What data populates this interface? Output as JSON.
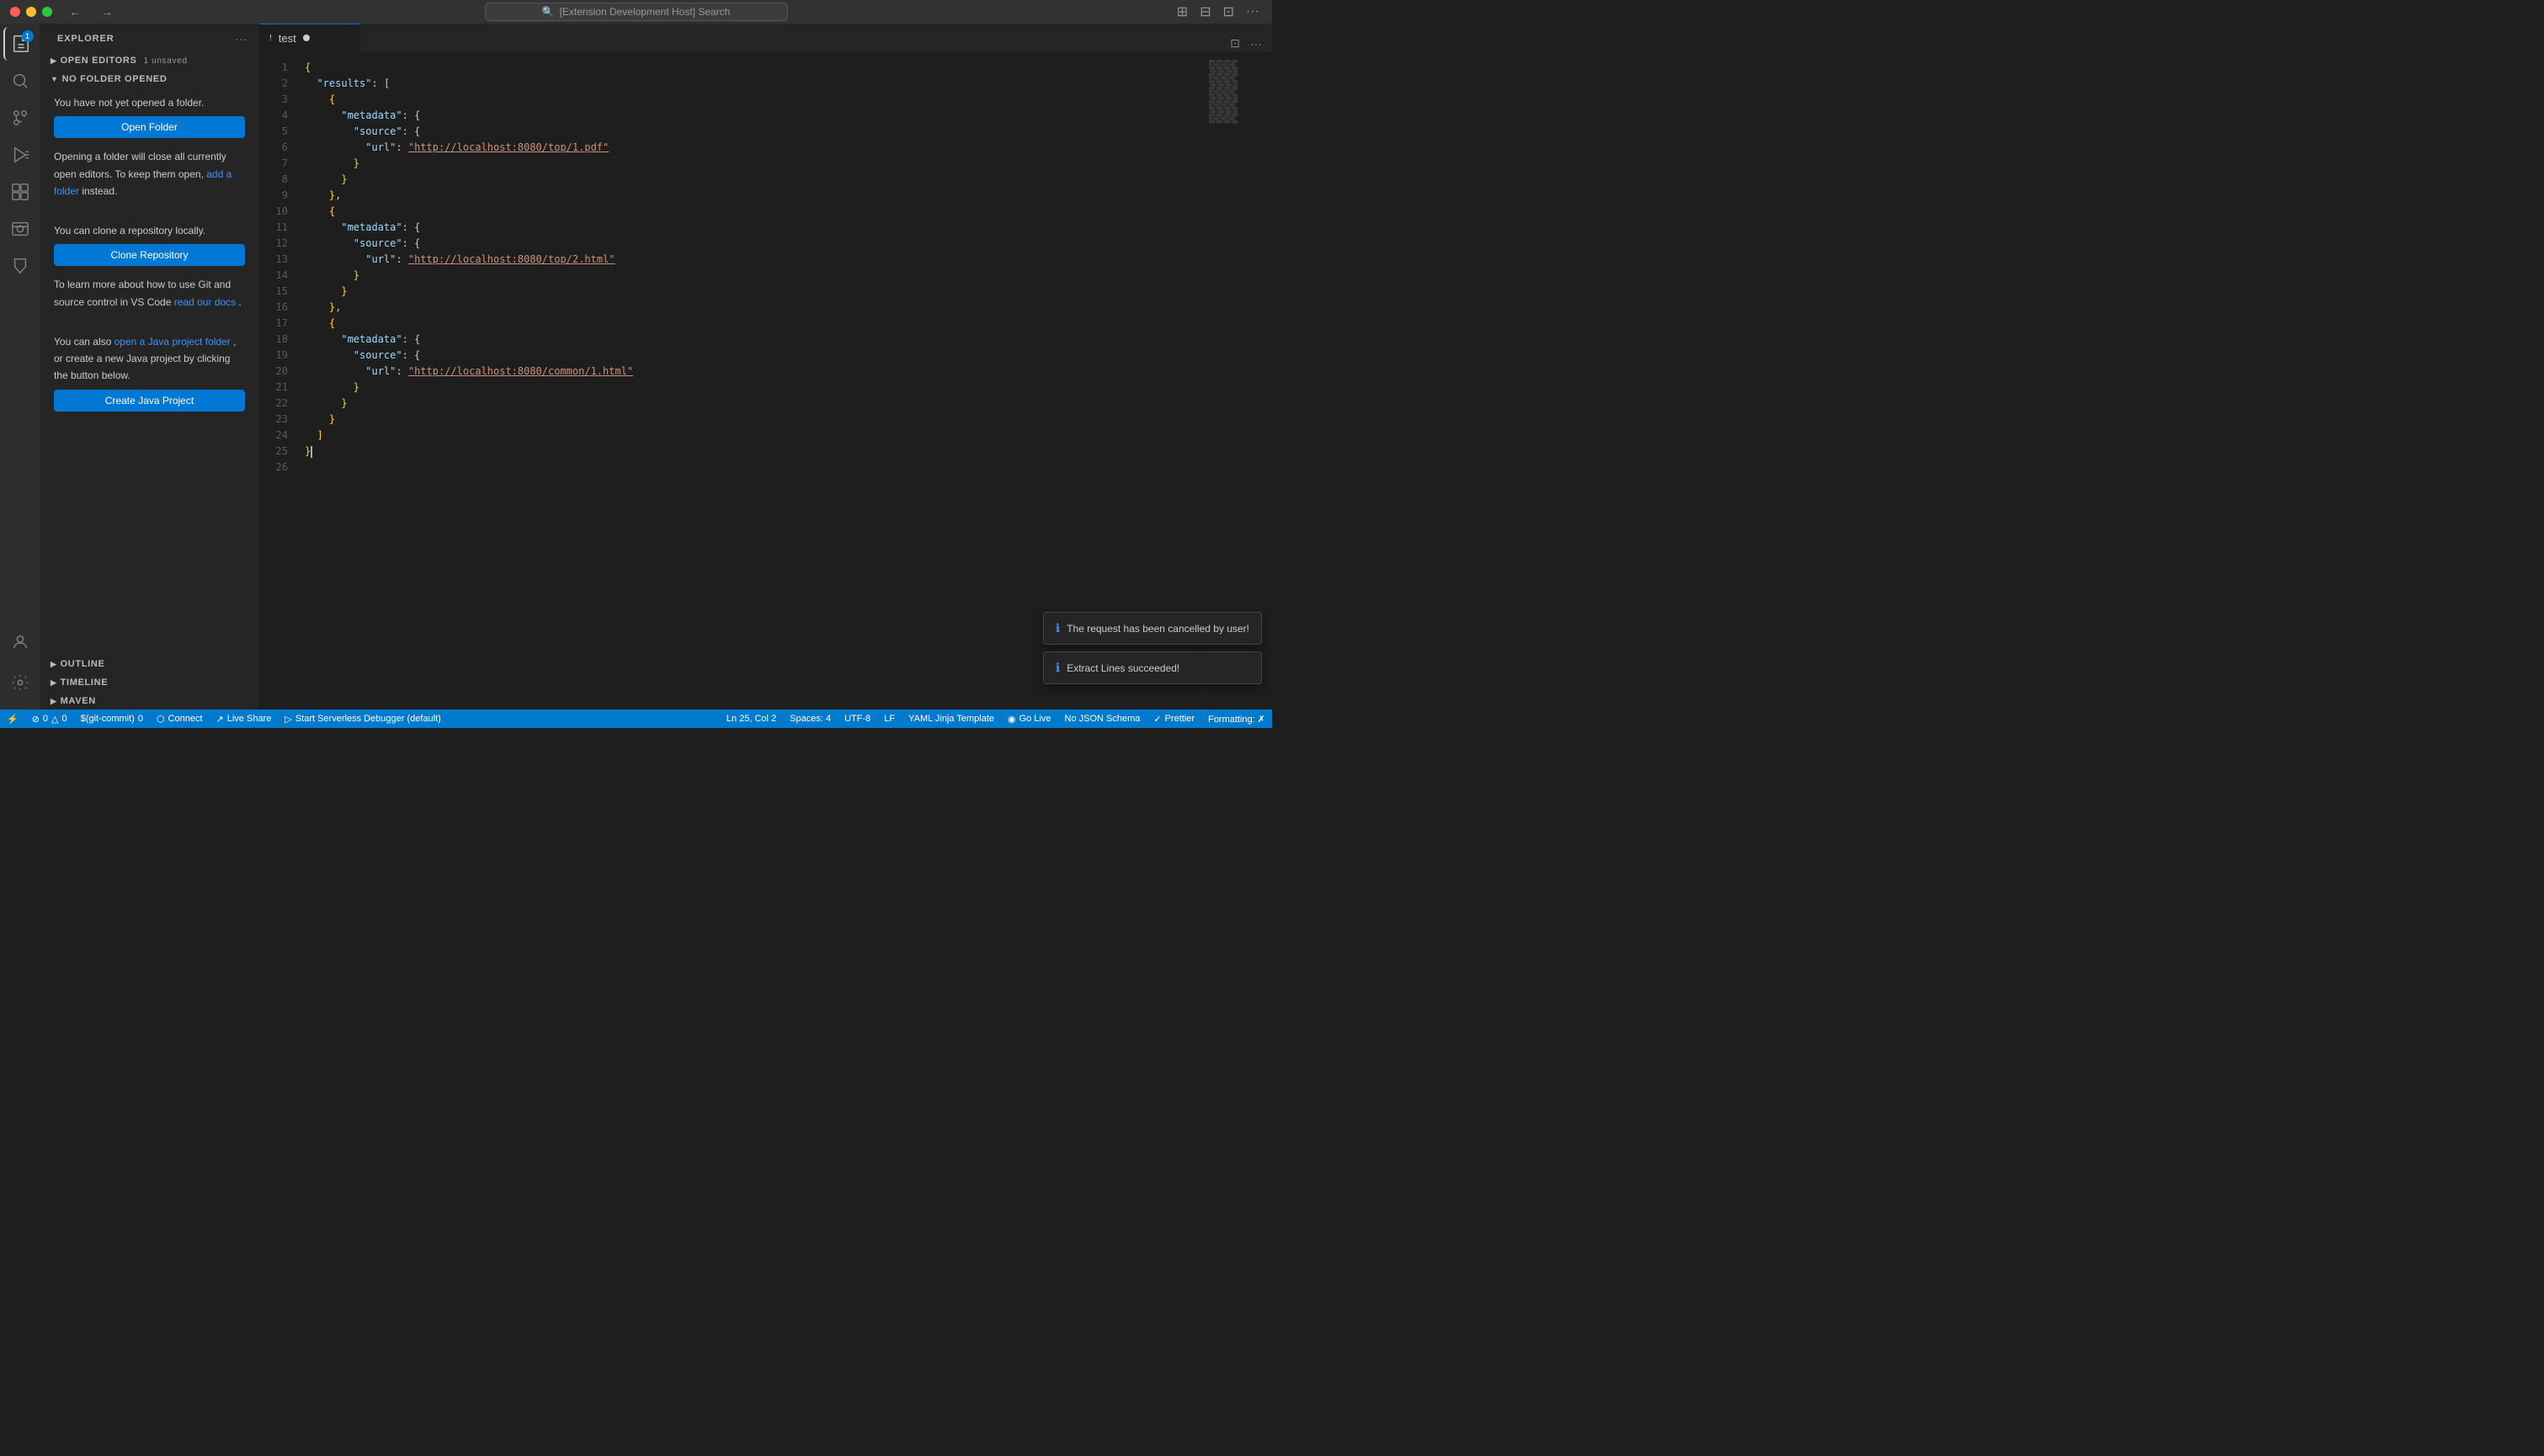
{
  "titlebar": {
    "search_placeholder": "[Extension Development Host] Search",
    "nav_back": "←",
    "nav_forward": "→"
  },
  "activity_bar": {
    "items": [
      {
        "id": "explorer",
        "icon": "files",
        "badge": "1",
        "active": true
      },
      {
        "id": "search",
        "icon": "search",
        "badge": null,
        "active": false
      },
      {
        "id": "source-control",
        "icon": "source-control",
        "badge": null,
        "active": false
      },
      {
        "id": "run",
        "icon": "run",
        "badge": null,
        "active": false
      },
      {
        "id": "extensions",
        "icon": "extensions",
        "badge": null,
        "active": false
      },
      {
        "id": "remote-explorer",
        "icon": "remote-explorer",
        "badge": null,
        "active": false
      },
      {
        "id": "testing",
        "icon": "testing",
        "badge": null,
        "active": false
      }
    ],
    "bottom_items": [
      {
        "id": "accounts",
        "icon": "accounts"
      },
      {
        "id": "settings",
        "icon": "settings"
      }
    ]
  },
  "sidebar": {
    "title": "Explorer",
    "sections": {
      "open_editors": {
        "label": "Open Editors",
        "badge": "1 unsaved",
        "collapsed": false
      },
      "no_folder": {
        "label": "No Folder Opened",
        "collapsed": false
      }
    },
    "content": {
      "no_folder_text": "You have not yet opened a folder.",
      "open_folder_btn": "Open Folder",
      "opening_note": "Opening a folder will close all currently open editors. To keep them open,",
      "add_folder_link": "add a folder",
      "add_folder_suffix": "instead.",
      "clone_note": "You can clone a repository locally.",
      "clone_btn": "Clone Repository",
      "git_note_prefix": "To learn more about how to use Git and source control in VS Code",
      "read_docs_link": "read our docs",
      "read_docs_suffix": ".",
      "java_note_prefix": "You can also",
      "open_java_link": "open a Java project folder",
      "java_note_mid": ", or create a new Java project by clicking the button below.",
      "create_java_btn": "Create Java Project"
    },
    "outline_label": "Outline",
    "timeline_label": "Timeline",
    "maven_label": "Maven"
  },
  "editor": {
    "tab_name": "test",
    "tab_unsaved": true,
    "lines": [
      {
        "num": 1,
        "content": "{",
        "tokens": [
          {
            "t": "bracket",
            "v": "{"
          }
        ]
      },
      {
        "num": 2,
        "content": "  \"results\": [",
        "tokens": [
          {
            "t": "indent",
            "v": "  "
          },
          {
            "t": "key",
            "v": "\"results\""
          },
          {
            "t": "colon",
            "v": ":"
          },
          {
            "t": "punct",
            "v": " ["
          }
        ]
      },
      {
        "num": 3,
        "content": "    {",
        "tokens": [
          {
            "t": "indent",
            "v": "    "
          },
          {
            "t": "bracket",
            "v": "{"
          }
        ]
      },
      {
        "num": 4,
        "content": "      \"metadata\": {",
        "tokens": [
          {
            "t": "indent",
            "v": "      "
          },
          {
            "t": "key",
            "v": "\"metadata\""
          },
          {
            "t": "colon",
            "v": ":"
          },
          {
            "t": "punct",
            "v": " {"
          }
        ]
      },
      {
        "num": 5,
        "content": "        \"source\": {",
        "tokens": [
          {
            "t": "indent",
            "v": "        "
          },
          {
            "t": "key",
            "v": "\"source\""
          },
          {
            "t": "colon",
            "v": ":"
          },
          {
            "t": "punct",
            "v": " {"
          }
        ]
      },
      {
        "num": 6,
        "content": "          \"url\": \"http://localhost:8080/top/1.pdf\"",
        "tokens": [
          {
            "t": "indent",
            "v": "          "
          },
          {
            "t": "key",
            "v": "\"url\""
          },
          {
            "t": "colon",
            "v": ":"
          },
          {
            "t": "str",
            "v": " \"http://localhost:8080/top/1.pdf\"",
            "url": true
          }
        ]
      },
      {
        "num": 7,
        "content": "        }",
        "tokens": [
          {
            "t": "indent",
            "v": "        "
          },
          {
            "t": "bracket",
            "v": "}"
          }
        ]
      },
      {
        "num": 8,
        "content": "      }",
        "tokens": [
          {
            "t": "indent",
            "v": "      "
          },
          {
            "t": "bracket",
            "v": "}"
          }
        ]
      },
      {
        "num": 9,
        "content": "    },",
        "tokens": [
          {
            "t": "indent",
            "v": "    "
          },
          {
            "t": "bracket",
            "v": "}"
          },
          {
            "t": "punct",
            "v": ","
          }
        ]
      },
      {
        "num": 10,
        "content": "    {",
        "tokens": [
          {
            "t": "indent",
            "v": "    "
          },
          {
            "t": "bracket",
            "v": "{"
          }
        ]
      },
      {
        "num": 11,
        "content": "      \"metadata\": {",
        "tokens": [
          {
            "t": "indent",
            "v": "      "
          },
          {
            "t": "key",
            "v": "\"metadata\""
          },
          {
            "t": "colon",
            "v": ":"
          },
          {
            "t": "punct",
            "v": " {"
          }
        ]
      },
      {
        "num": 12,
        "content": "        \"source\": {",
        "tokens": [
          {
            "t": "indent",
            "v": "        "
          },
          {
            "t": "key",
            "v": "\"source\""
          },
          {
            "t": "colon",
            "v": ":"
          },
          {
            "t": "punct",
            "v": " {"
          }
        ]
      },
      {
        "num": 13,
        "content": "          \"url\": \"http://localhost:8080/top/2.html\"",
        "tokens": [
          {
            "t": "indent",
            "v": "          "
          },
          {
            "t": "key",
            "v": "\"url\""
          },
          {
            "t": "colon",
            "v": ":"
          },
          {
            "t": "str",
            "v": " \"http://localhost:8080/top/2.html\"",
            "url": true
          }
        ]
      },
      {
        "num": 14,
        "content": "        }",
        "tokens": [
          {
            "t": "indent",
            "v": "        "
          },
          {
            "t": "bracket",
            "v": "}"
          }
        ]
      },
      {
        "num": 15,
        "content": "      }",
        "tokens": [
          {
            "t": "indent",
            "v": "      "
          },
          {
            "t": "bracket",
            "v": "}"
          }
        ]
      },
      {
        "num": 16,
        "content": "    },",
        "tokens": [
          {
            "t": "indent",
            "v": "    "
          },
          {
            "t": "bracket",
            "v": "}"
          },
          {
            "t": "punct",
            "v": ","
          }
        ]
      },
      {
        "num": 17,
        "content": "    {",
        "tokens": [
          {
            "t": "indent",
            "v": "    "
          },
          {
            "t": "bracket",
            "v": "{"
          }
        ]
      },
      {
        "num": 18,
        "content": "      \"metadata\": {",
        "tokens": [
          {
            "t": "indent",
            "v": "      "
          },
          {
            "t": "key",
            "v": "\"metadata\""
          },
          {
            "t": "colon",
            "v": ":"
          },
          {
            "t": "punct",
            "v": " {"
          }
        ]
      },
      {
        "num": 19,
        "content": "        \"source\": {",
        "tokens": [
          {
            "t": "indent",
            "v": "        "
          },
          {
            "t": "key",
            "v": "\"source\""
          },
          {
            "t": "colon",
            "v": ":"
          },
          {
            "t": "punct",
            "v": " {"
          }
        ]
      },
      {
        "num": 20,
        "content": "          \"url\": \"http://localhost:8080/common/1.html\"",
        "tokens": [
          {
            "t": "indent",
            "v": "          "
          },
          {
            "t": "key",
            "v": "\"url\""
          },
          {
            "t": "colon",
            "v": ":"
          },
          {
            "t": "str",
            "v": " \"http://localhost:8080/common/1.html\"",
            "url": true
          }
        ]
      },
      {
        "num": 21,
        "content": "        }",
        "tokens": [
          {
            "t": "indent",
            "v": "        "
          },
          {
            "t": "bracket",
            "v": "}"
          }
        ]
      },
      {
        "num": 22,
        "content": "      }",
        "tokens": [
          {
            "t": "indent",
            "v": "      "
          },
          {
            "t": "bracket",
            "v": "}"
          }
        ]
      },
      {
        "num": 23,
        "content": "    }",
        "tokens": [
          {
            "t": "indent",
            "v": "    "
          },
          {
            "t": "bracket",
            "v": "}"
          }
        ]
      },
      {
        "num": 24,
        "content": "  ]",
        "tokens": [
          {
            "t": "indent",
            "v": "  "
          },
          {
            "t": "bracket",
            "v": "]"
          }
        ]
      },
      {
        "num": 25,
        "content": "}",
        "tokens": [
          {
            "t": "bracket",
            "v": "}"
          }
        ]
      },
      {
        "num": 26,
        "content": "",
        "tokens": []
      }
    ]
  },
  "status_bar": {
    "left": [
      {
        "id": "remote",
        "icon": "⚡",
        "text": ""
      },
      {
        "id": "errors",
        "icon": "⊘",
        "text": "0  △ 0"
      },
      {
        "id": "gitlens",
        "icon": "",
        "text": "0"
      },
      {
        "id": "connect",
        "icon": "⬡",
        "text": "Connect"
      },
      {
        "id": "live-share",
        "icon": "↗",
        "text": "Live Share"
      },
      {
        "id": "serverless",
        "icon": "▷",
        "text": "Start Serverless Debugger (default)"
      }
    ],
    "right": [
      {
        "id": "position",
        "text": "Ln 25, Col 2"
      },
      {
        "id": "spaces",
        "text": "Spaces: 4"
      },
      {
        "id": "encoding",
        "text": "UTF-8"
      },
      {
        "id": "eol",
        "text": "LF"
      },
      {
        "id": "language",
        "text": "YAML Jinja Template"
      },
      {
        "id": "go-live",
        "icon": "◉",
        "text": "Go Live"
      },
      {
        "id": "json-schema",
        "text": "No JSON Schema"
      },
      {
        "id": "prettier",
        "text": "Prettier"
      },
      {
        "id": "formatting",
        "text": "Formatting: ✗"
      }
    ]
  },
  "notifications": [
    {
      "id": "cancel-notif",
      "icon": "ℹ",
      "text": "The request has been cancelled by user!"
    },
    {
      "id": "extract-notif",
      "icon": "ℹ",
      "text": "Extract Lines succeeded!"
    }
  ]
}
